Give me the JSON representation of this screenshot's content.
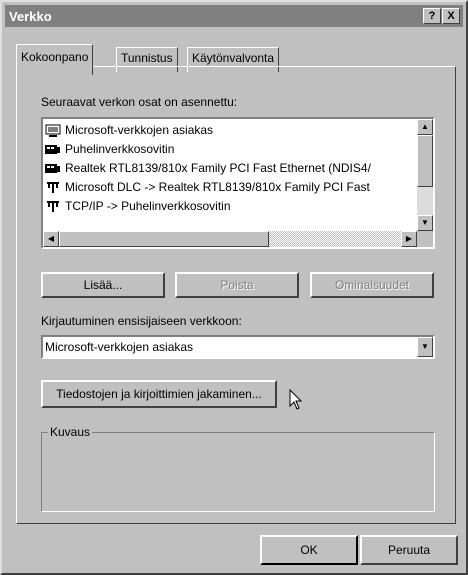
{
  "window": {
    "title": "Verkko"
  },
  "titlebar_buttons": {
    "help": "?",
    "close": "X"
  },
  "tabs": [
    "Kokoonpano",
    "Tunnistus",
    "Käytönvalvonta"
  ],
  "installed_label": "Seuraavat verkon osat on asennettu:",
  "components": [
    {
      "label": "Microsoft-verkkojen asiakas",
      "icon": "network-client-icon"
    },
    {
      "label": "Puhelinverkkosovitin",
      "icon": "adapter-icon"
    },
    {
      "label": "Realtek RTL8139/810x Family PCI Fast Ethernet (NDIS4/",
      "icon": "adapter-icon"
    },
    {
      "label": "Microsoft DLC -> Realtek RTL8139/810x Family PCI Fast",
      "icon": "protocol-icon"
    },
    {
      "label": "TCP/IP -> Puhelinverkkosovitin",
      "icon": "protocol-icon"
    }
  ],
  "buttons": {
    "add": "Lisää...",
    "remove": "Poista",
    "properties": "Ominaisuudet"
  },
  "login_label": "Kirjautuminen ensisijaiseen verkkoon:",
  "login_value": "Microsoft-verkkojen asiakas",
  "sharing_button": "Tiedostojen ja kirjoittimien jakaminen...",
  "description_label": "Kuvaus",
  "ok": "OK",
  "cancel": "Peruuta"
}
